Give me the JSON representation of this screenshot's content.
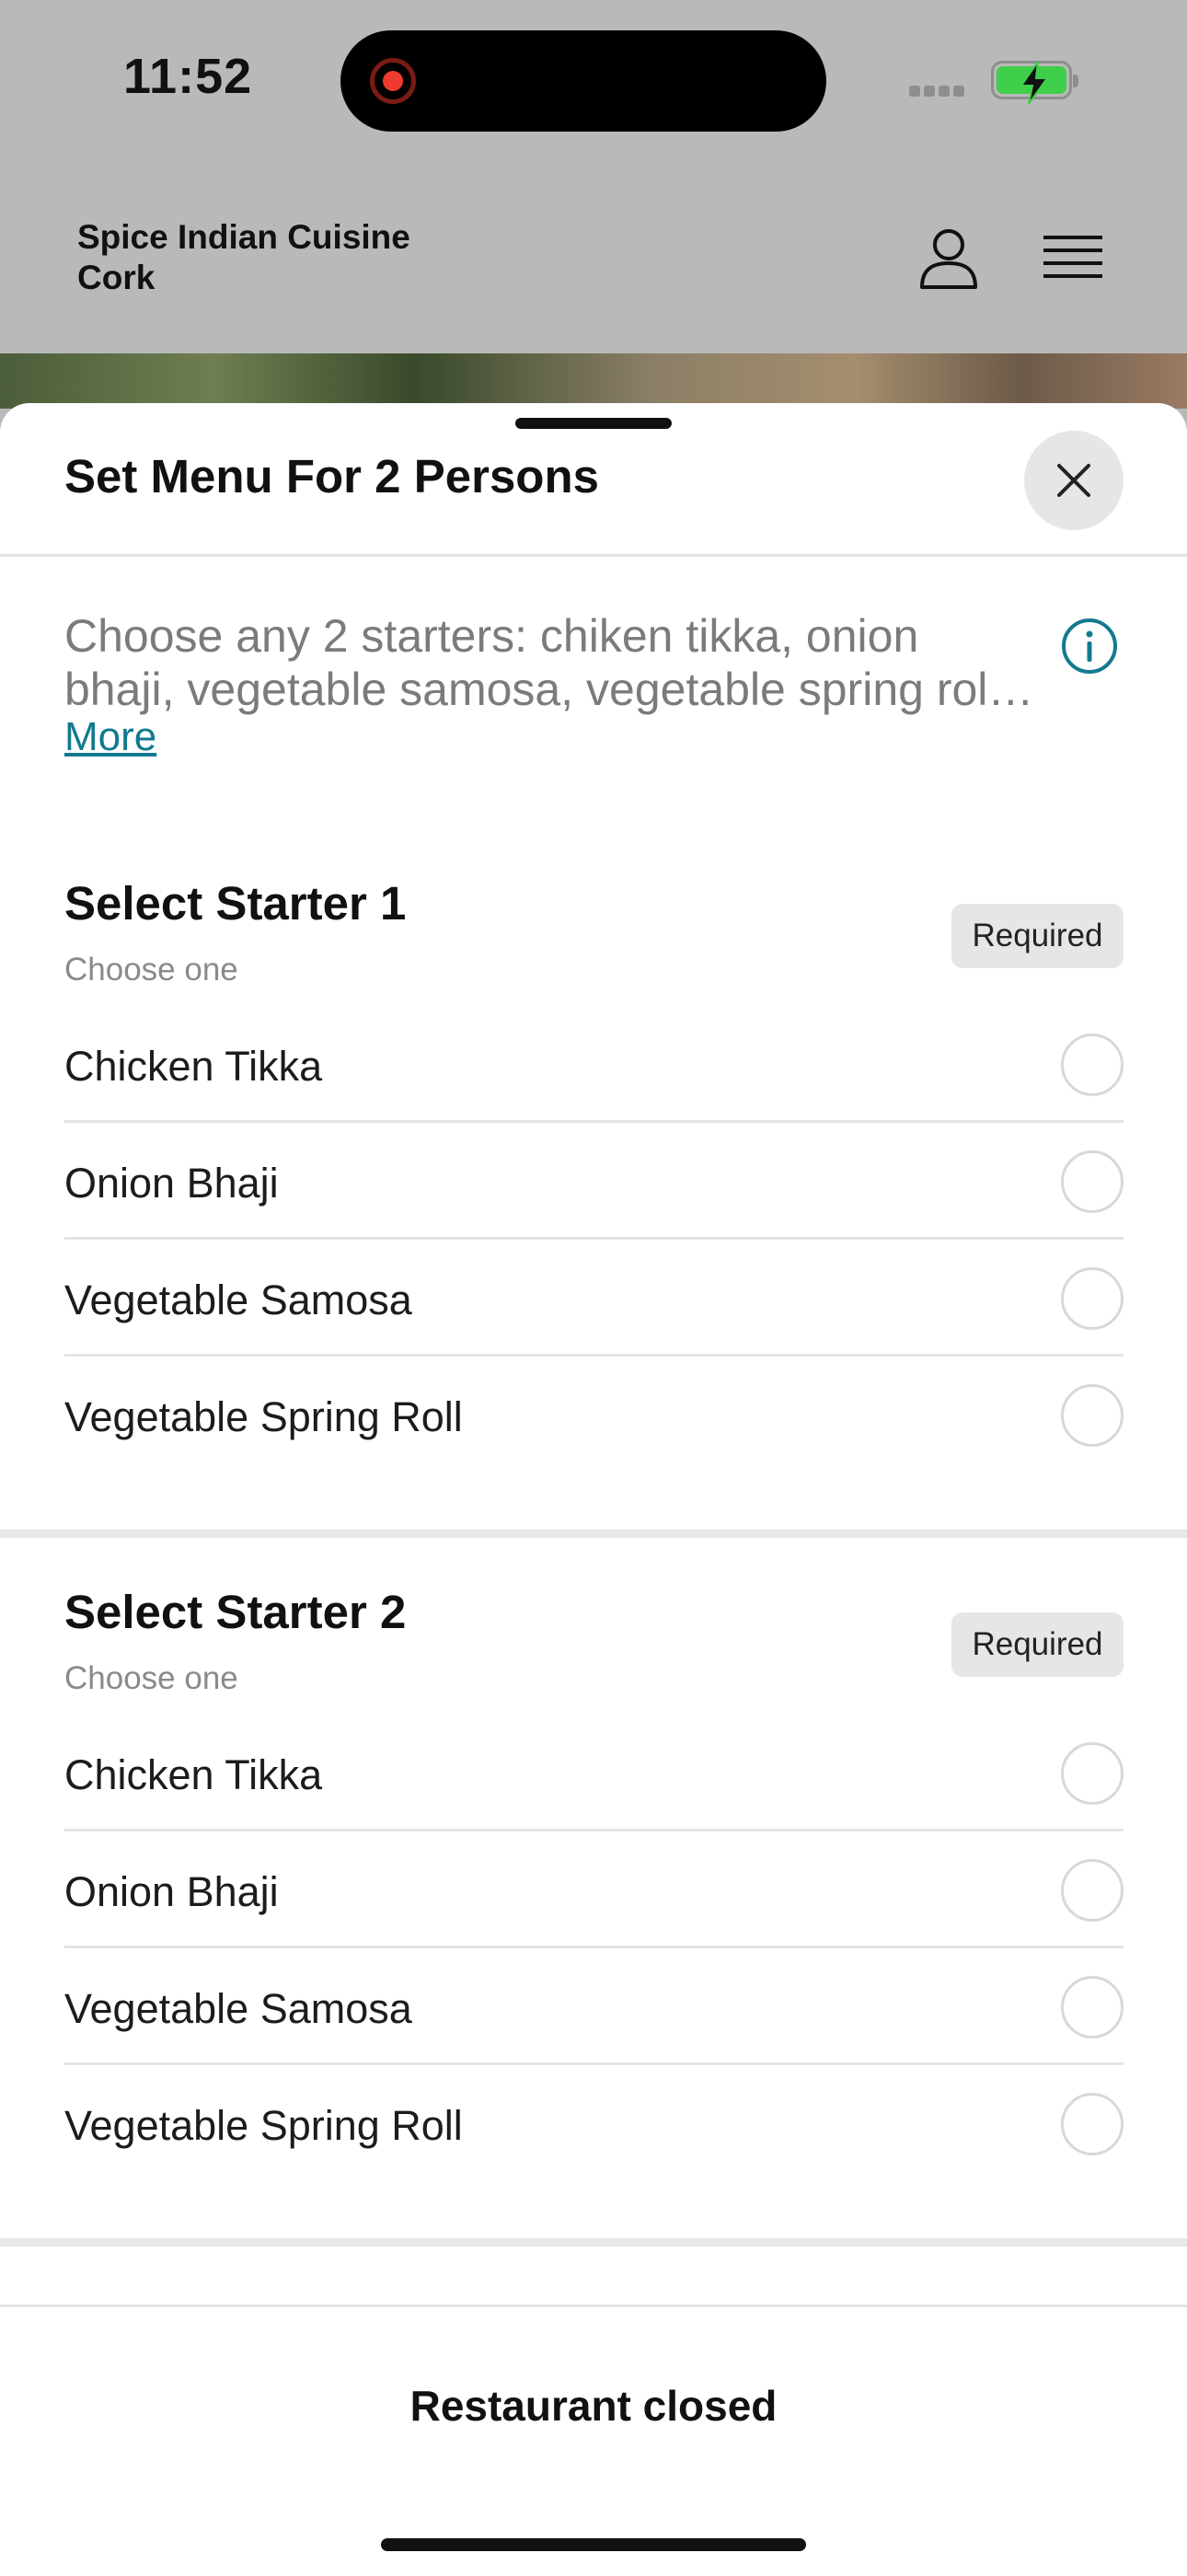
{
  "status_bar": {
    "time": "11:52",
    "battery_color": "#3fcf4a",
    "recording_color": "#ef3b2d"
  },
  "header": {
    "restaurant_name_line1": "Spice Indian Cuisine",
    "restaurant_name_line2": "Cork",
    "account_icon": "person-icon",
    "menu_icon": "hamburger-menu-icon"
  },
  "sheet": {
    "title": "Set Menu For 2 Persons",
    "close_icon": "close-icon",
    "description_line1": "Choose any 2 starters: chiken tikka, onion",
    "description_line2": "bhaji, vegetable samosa, vegetable spring rol…",
    "more_label": "More",
    "info_icon": "info-icon",
    "accent_color": "#127a8f",
    "groups": [
      {
        "title": "Select Starter 1",
        "subtitle": "Choose one",
        "badge": "Required",
        "options": [
          {
            "label": "Chicken Tikka",
            "selected": false
          },
          {
            "label": "Onion Bhaji",
            "selected": false
          },
          {
            "label": "Vegetable Samosa",
            "selected": false
          },
          {
            "label": "Vegetable Spring Roll",
            "selected": false
          }
        ]
      },
      {
        "title": "Select Starter 2",
        "subtitle": "Choose one",
        "badge": "Required",
        "options": [
          {
            "label": "Chicken Tikka",
            "selected": false
          },
          {
            "label": "Onion Bhaji",
            "selected": false
          },
          {
            "label": "Vegetable Samosa",
            "selected": false
          },
          {
            "label": "Vegetable Spring Roll",
            "selected": false
          }
        ]
      }
    ]
  },
  "footer": {
    "status": "Restaurant closed"
  }
}
